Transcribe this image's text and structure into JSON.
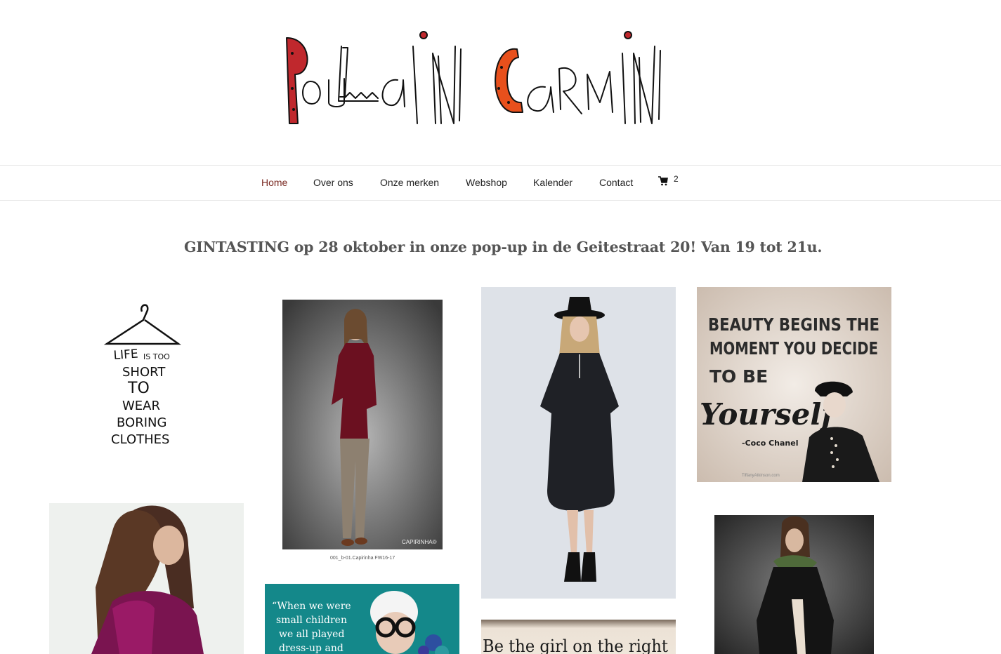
{
  "site": {
    "logo_text": "Poulain Carmin"
  },
  "nav": {
    "items": [
      {
        "label": "Home",
        "active": true
      },
      {
        "label": "Over ons",
        "active": false
      },
      {
        "label": "Onze merken",
        "active": false
      },
      {
        "label": "Webshop",
        "active": false
      },
      {
        "label": "Kalender",
        "active": false
      },
      {
        "label": "Contact",
        "active": false
      }
    ],
    "cart_icon": "cart-icon",
    "cart_count": "2"
  },
  "announcement": "GINTASTING op 28 oktober in onze pop-up in de Geitestraat 20! Van 19 tot 21u.",
  "gallery": {
    "tile1": {
      "lines": [
        "LIFE",
        "IS TOO",
        "SHORT",
        "TO",
        "WEAR",
        "BORING",
        "CLOTHES"
      ]
    },
    "tile2": {
      "brand": "CAPIRINHA®",
      "caption": "001_b-01.Capirinha FW16-17"
    },
    "tile4": {
      "line1": "BEAUTY BEGINS THE",
      "line2": "MOMENT YOU DECIDE",
      "line3": "TO BE",
      "script": "Yourself",
      "author": "-Coco Chanel",
      "credit": "TiffanyAtkinson.com"
    },
    "tile6": {
      "lines": [
        "“When we were",
        "small children",
        "we all played",
        "dress-up and"
      ]
    },
    "tile7": {
      "text": "Be the girl on the right"
    }
  },
  "colors": {
    "accent": "#7a2a22",
    "logo_red": "#c0282d",
    "logo_orange": "#e8501c",
    "announcement": "#555555"
  }
}
